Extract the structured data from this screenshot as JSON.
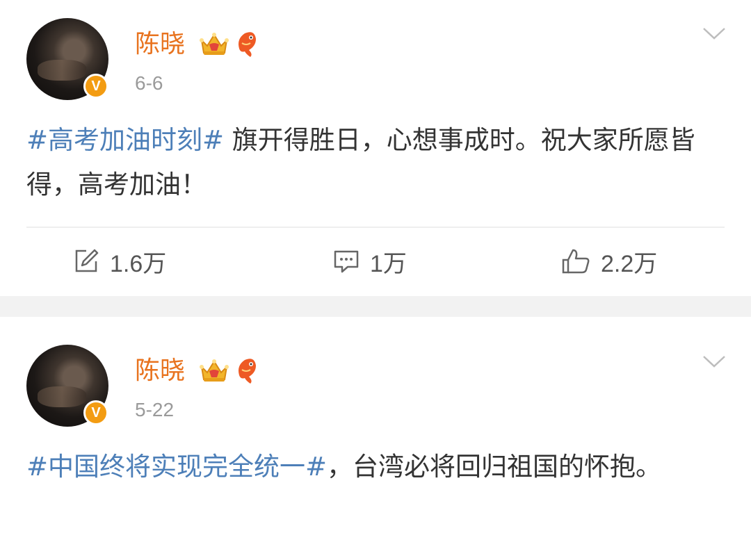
{
  "posts": [
    {
      "author": "陈晓",
      "date": "6-6",
      "hashtag": "#高考加油时刻#",
      "body": " 旗开得胜日，心想事成时。祝大家所愿皆得，高考加油！",
      "stats": {
        "repost": "1.6万",
        "comment": "1万",
        "like": "2.2万"
      }
    },
    {
      "author": "陈晓",
      "date": "5-22",
      "hashtag": "#中国终将实现完全统一#",
      "body": "，台湾必将回归祖国的怀抱。"
    }
  ],
  "colors": {
    "name": "#e8731f",
    "hashtag": "#4d7fb8",
    "verified_badge": "#f39c12",
    "separator": "#f2f2f2"
  },
  "icons": [
    "verified-v-icon",
    "crown-icon",
    "fish-badge-icon",
    "chevron-down-icon",
    "repost-icon",
    "comment-icon",
    "like-icon"
  ]
}
